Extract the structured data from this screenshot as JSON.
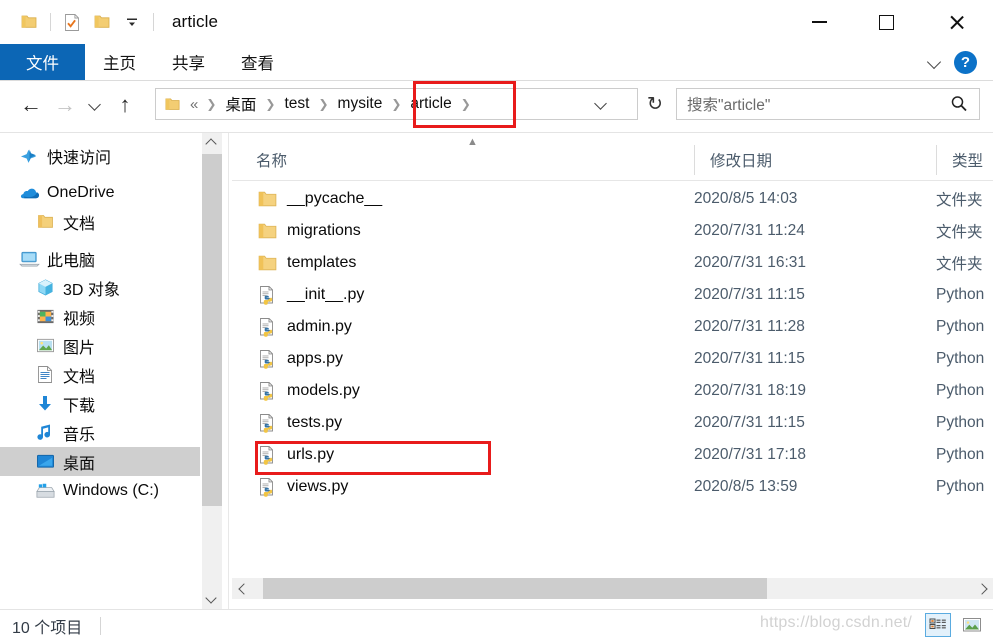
{
  "window": {
    "title": "article",
    "minimize_label": "最小化",
    "maximize_label": "最大化",
    "close_label": "关闭"
  },
  "quick_access_toolbar": {
    "items": [
      {
        "name": "folder-icon",
        "label": ""
      },
      {
        "name": "properties-icon",
        "label": ""
      },
      {
        "name": "new-folder-icon",
        "label": ""
      },
      {
        "name": "customize-dropdown-icon",
        "label": ""
      }
    ]
  },
  "ribbon": {
    "tabs": [
      {
        "label": "文件",
        "selected": true
      },
      {
        "label": "主页",
        "selected": false
      },
      {
        "label": "共享",
        "selected": false
      },
      {
        "label": "查看",
        "selected": false
      }
    ],
    "expand_label": "",
    "help_label": "?"
  },
  "navigation": {
    "back_label": "←",
    "forward_label": "→",
    "recent_label": "",
    "up_label": "↑"
  },
  "address_bar": {
    "overflow": "«",
    "crumbs": [
      "桌面",
      "test",
      "mysite",
      "article"
    ],
    "highlighted_crumb": "article",
    "dropdown_label": "",
    "refresh_label": "↻"
  },
  "search": {
    "placeholder": "搜索\"article\"",
    "icon": "search-icon"
  },
  "sidebar": {
    "items": [
      {
        "label": "快速访问",
        "icon": "quick-access-icon",
        "level": 0,
        "selected": false
      },
      {
        "label": "OneDrive",
        "icon": "onedrive-cloud-icon",
        "level": 0,
        "selected": false
      },
      {
        "label": "文档",
        "icon": "folder-icon",
        "level": 1,
        "selected": false
      },
      {
        "label": "此电脑",
        "icon": "this-pc-icon",
        "level": 0,
        "selected": false
      },
      {
        "label": "3D 对象",
        "icon": "3d-objects-icon",
        "level": 1,
        "selected": false
      },
      {
        "label": "视频",
        "icon": "videos-icon",
        "level": 1,
        "selected": false
      },
      {
        "label": "图片",
        "icon": "pictures-icon",
        "level": 1,
        "selected": false
      },
      {
        "label": "文档",
        "icon": "documents-icon",
        "level": 1,
        "selected": false
      },
      {
        "label": "下载",
        "icon": "downloads-icon",
        "level": 1,
        "selected": false
      },
      {
        "label": "音乐",
        "icon": "music-icon",
        "level": 1,
        "selected": false
      },
      {
        "label": "桌面",
        "icon": "desktop-icon",
        "level": 1,
        "selected": true
      },
      {
        "label": "Windows (C:)",
        "icon": "drive-icon",
        "level": 1,
        "selected": false
      }
    ]
  },
  "file_list": {
    "columns": [
      "名称",
      "修改日期",
      "类型"
    ],
    "sort_column": "名称",
    "sort_direction": "asc",
    "highlighted_row": "urls.py",
    "rows": [
      {
        "name": "__pycache__",
        "date": "2020/8/5 14:03",
        "type": "文件夹",
        "icon": "folder-icon"
      },
      {
        "name": "migrations",
        "date": "2020/7/31 11:24",
        "type": "文件夹",
        "icon": "folder-icon"
      },
      {
        "name": "templates",
        "date": "2020/7/31 16:31",
        "type": "文件夹",
        "icon": "folder-icon"
      },
      {
        "name": "__init__.py",
        "date": "2020/7/31 11:15",
        "type": "Python",
        "icon": "python-file-icon"
      },
      {
        "name": "admin.py",
        "date": "2020/7/31 11:28",
        "type": "Python",
        "icon": "python-file-icon"
      },
      {
        "name": "apps.py",
        "date": "2020/7/31 11:15",
        "type": "Python",
        "icon": "python-file-icon"
      },
      {
        "name": "models.py",
        "date": "2020/7/31 18:19",
        "type": "Python",
        "icon": "python-file-icon"
      },
      {
        "name": "tests.py",
        "date": "2020/7/31 11:15",
        "type": "Python",
        "icon": "python-file-icon"
      },
      {
        "name": "urls.py",
        "date": "2020/7/31 17:18",
        "type": "Python",
        "icon": "python-file-icon"
      },
      {
        "name": "views.py",
        "date": "2020/8/5 13:59",
        "type": "Python",
        "icon": "python-file-icon"
      }
    ]
  },
  "status_bar": {
    "item_count": "10 个项目",
    "view_details_label": "",
    "view_large_icons_label": ""
  },
  "watermark": "https://blog.csdn.net/",
  "colors": {
    "accent_blue": "#0c66b5",
    "highlight_red": "#e81b1b",
    "selected_gray": "#cfcfcf",
    "header_text": "#4b5b6b",
    "folder_yellow": "#f5cd6a"
  }
}
